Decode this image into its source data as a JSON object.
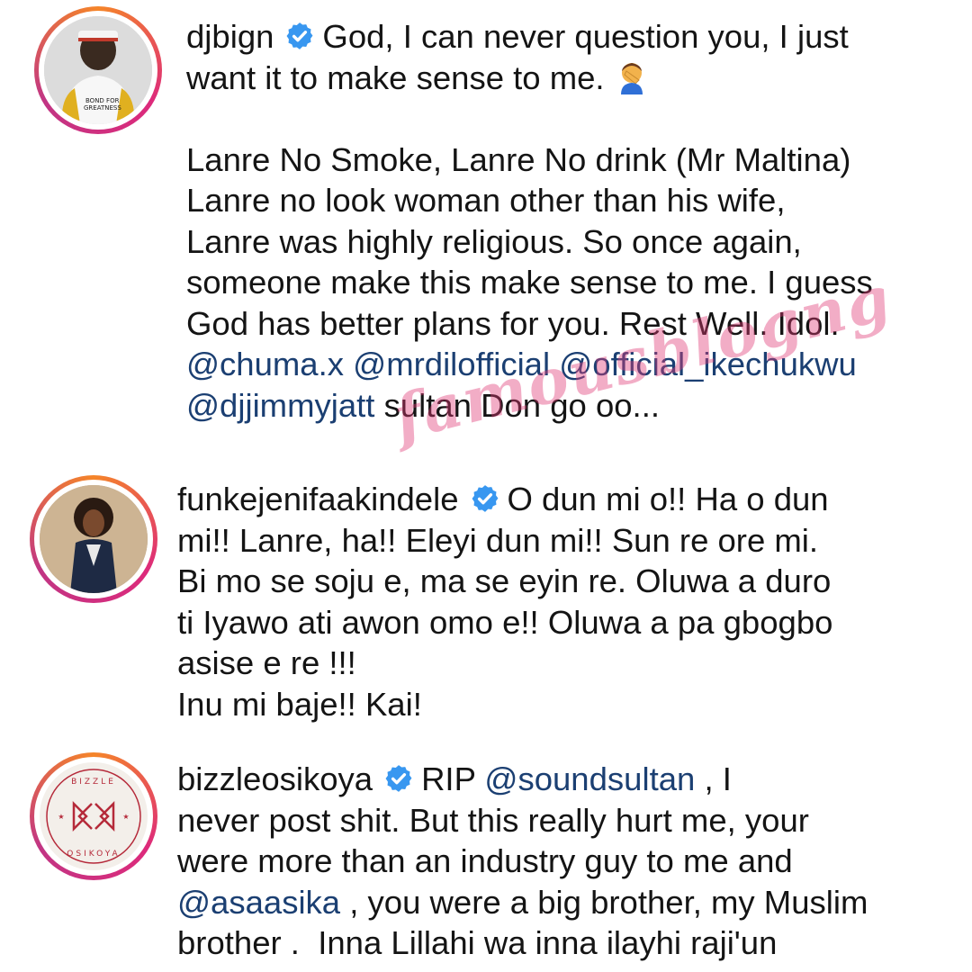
{
  "watermark": "famousblogng",
  "colors": {
    "mention": "#1b3f72",
    "verified": "#3897f0",
    "watermark": "#e03c78"
  },
  "posts": [
    {
      "username": "djbign",
      "verified": true,
      "avatar_icon": "user-avatar-photo",
      "line1_text": "God, I can never question you, I just\nwant it to make sense to me.",
      "emoji": "facepalm",
      "body_text": "\n\nLanre No Smoke, Lanre No drink (Mr Maltina)\nLanre no look woman other than his wife,\nLanre was highly religious. So once again,\nsomeone make this make sense to me. I guess\nGod has better plans for you. Rest Well. Idol.\n",
      "mentions": [
        "@chuma.x",
        "@mrdilofficial",
        "@official_ikechukwu",
        "@djjimmyjatt"
      ],
      "tail_text": " sultan Don go oo..."
    },
    {
      "username": "funkejenifaakindele",
      "verified": true,
      "avatar_icon": "user-avatar-photo",
      "text": "O dun mi o!! Ha o dun\nmi!! Lanre, ha!! Eleyi dun mi!! Sun re ore mi.\nBi mo se soju e, ma se eyin re. Oluwa a duro\nti Iyawo ati awon omo e!! Oluwa a pa gbogbo\nasise e re !!!\nInu mi baje!! Kai!"
    },
    {
      "username": "bizzleosikoya",
      "verified": true,
      "avatar_icon": "brand-logo",
      "avatar_logo_text_top": "BIZZLE",
      "avatar_logo_text_bottom": "OSIKOYA",
      "text_a": "RIP ",
      "mention_a": "@soundsultan",
      "text_b": " , I\nnever post shit. But this really hurt me, your\nwere more than an industry guy to me and\n",
      "mention_b": "@asaasika",
      "text_c": " , you were a big brother, my Muslim\nbrother .  Inna Lillahi wa inna ilayhi raji'un"
    }
  ]
}
